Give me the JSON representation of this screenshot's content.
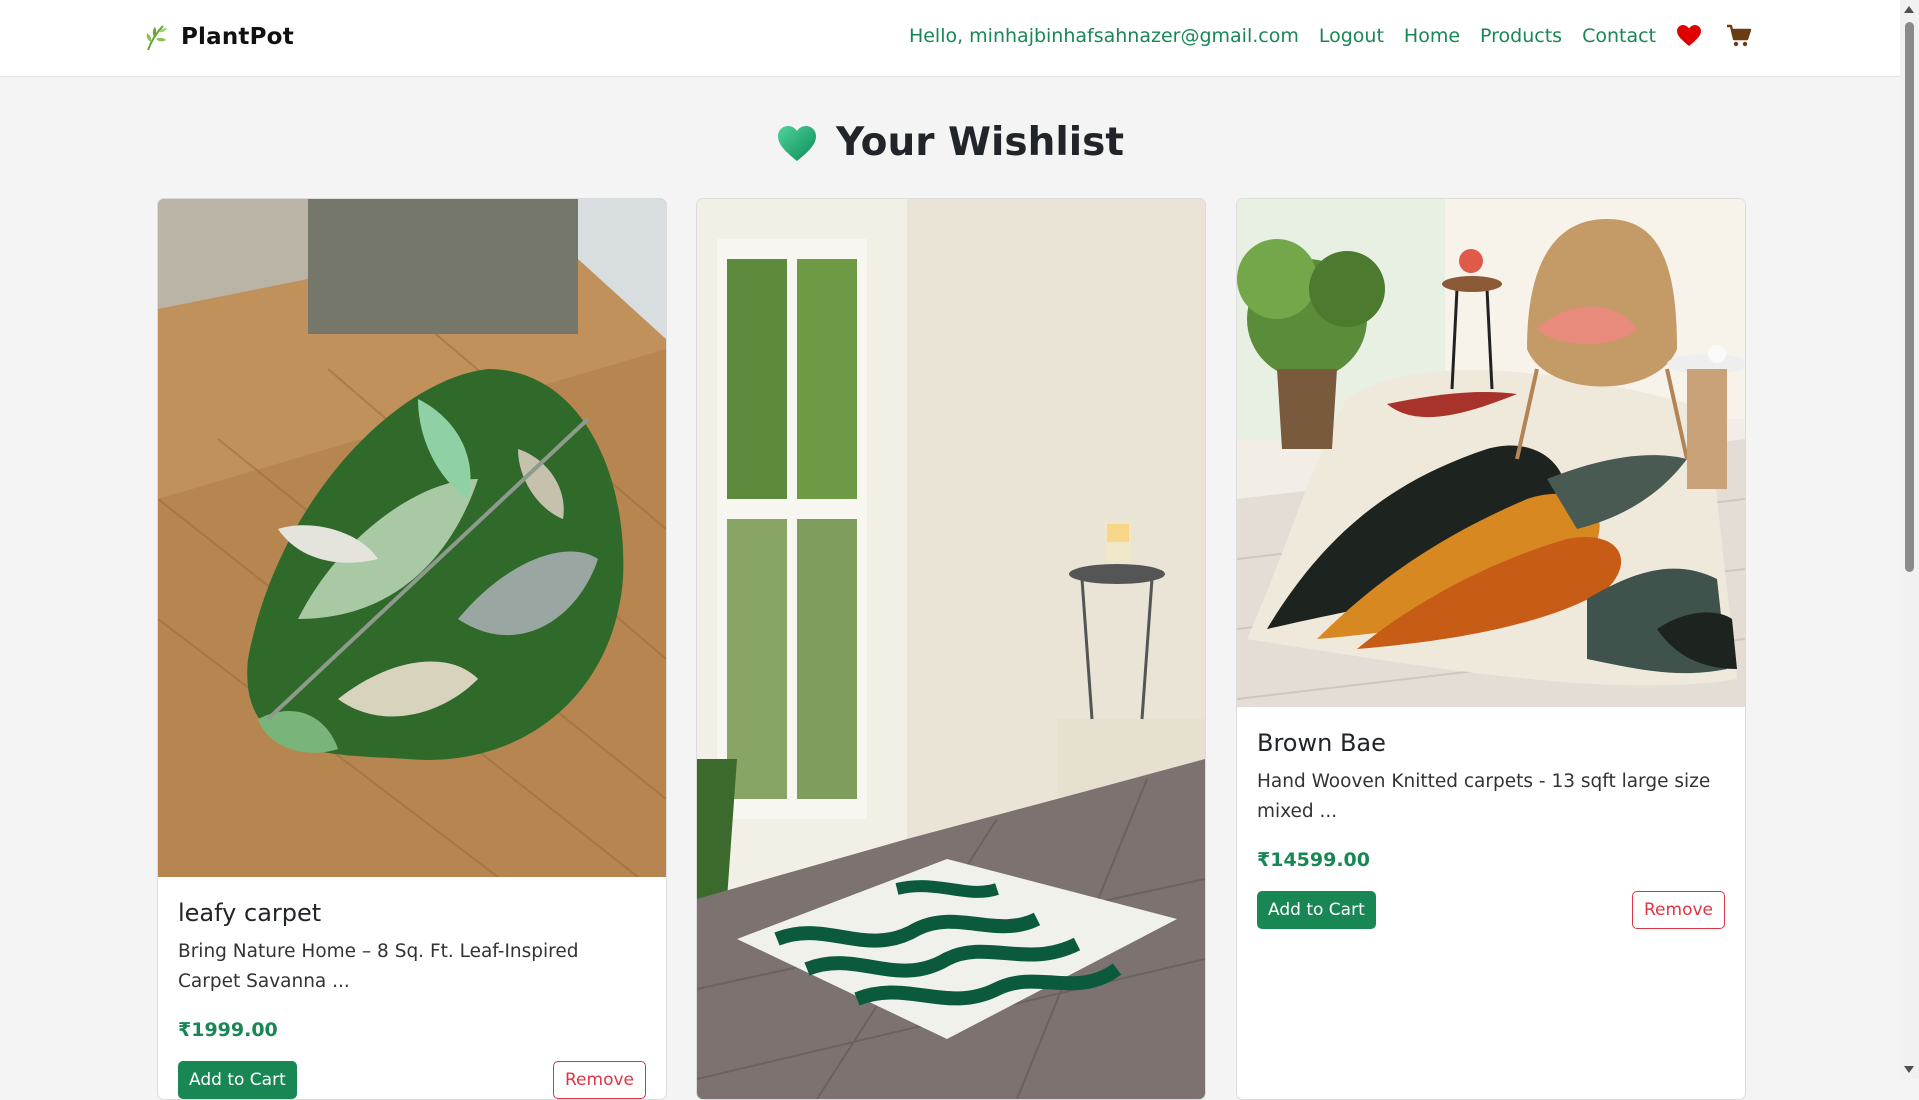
{
  "navbar": {
    "brand": "PlantPot",
    "greeting": "Hello, minhajbinhafsahnazer@gmail.com",
    "links": [
      "Logout",
      "Home",
      "Products",
      "Contact"
    ],
    "wishlist_icon": "heart-icon",
    "cart_icon": "cart-icon"
  },
  "page": {
    "title": "Your Wishlist",
    "title_icon": "green-heart-icon"
  },
  "colors": {
    "accent": "#198754",
    "danger": "#dc3545",
    "heart": "#e00000"
  },
  "wishlist": [
    {
      "name": "leafy carpet",
      "description": "Bring Nature Home – 8 Sq. Ft. Leaf-Inspired Carpet Savanna ...",
      "price": "₹1999.00",
      "add_label": "Add to Cart",
      "remove_label": "Remove"
    },
    {
      "name": "",
      "description": "",
      "price": "",
      "add_label": "",
      "remove_label": ""
    },
    {
      "name": "Brown Bae",
      "description": "Hand Wooven Knitted carpets - 13 sqft large size mixed ...",
      "price": "₹14599.00",
      "add_label": "Add to Cart",
      "remove_label": "Remove"
    }
  ]
}
